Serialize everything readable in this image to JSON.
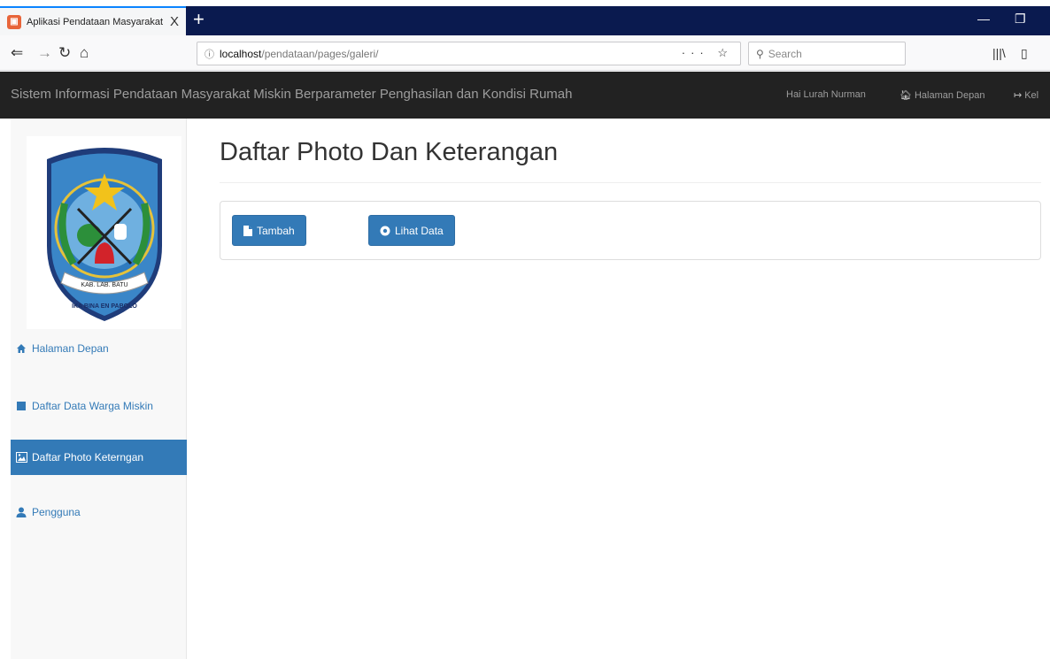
{
  "browser": {
    "tab_title": "Aplikasi Pendataan Masyarakat",
    "tab_close": "X",
    "new_tab": "+",
    "url_host": "localhost",
    "url_path": "/pendataan/pages/galeri/",
    "url_actions": "··· ☆",
    "search_placeholder": "Search"
  },
  "header": {
    "brand": "Sistem Informasi Pendataan Masyarakat Miskin Berparameter Penghasilan dan Kondisi Rumah",
    "greeting": "Hai Lurah Nurman",
    "home_link": "Halaman Depan",
    "logout_link": "Kel"
  },
  "logo": {
    "text_kab": "KAB. LAB. BATU",
    "motto": "IKA BINA EN PABOLO"
  },
  "sidebar": {
    "items": [
      {
        "label": "Halaman Depan"
      },
      {
        "label": "Daftar Data Warga Miskin"
      },
      {
        "label": "Daftar Photo Keterngan"
      },
      {
        "label": "Pengguna"
      }
    ]
  },
  "main": {
    "title": "Daftar Photo Dan Keterangan",
    "btn_add": "Tambah",
    "btn_view": "Lihat Data"
  },
  "colors": {
    "primary": "#337ab7",
    "header_bg": "#222222",
    "tabbar_bg": "#0a1a4f"
  }
}
